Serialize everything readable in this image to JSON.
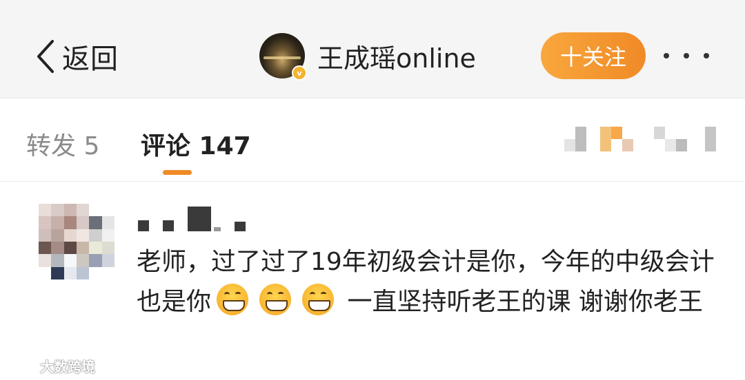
{
  "header": {
    "back_label": "返回",
    "username": "王成瑶online",
    "verified_badge": "v",
    "follow_label": "十关注",
    "accent": "#f08a26"
  },
  "tabs": {
    "repost_label": "转发 5",
    "comments_label": "评论 147"
  },
  "comment": {
    "text_part1": "老师，过了过了19年初级会计是你，今年的中级会计也是你",
    "emoji": "grin-emoji",
    "text_part2": " 一直坚持听老王的课 谢谢你老王"
  },
  "watermark": {
    "text": "大数跨境"
  }
}
